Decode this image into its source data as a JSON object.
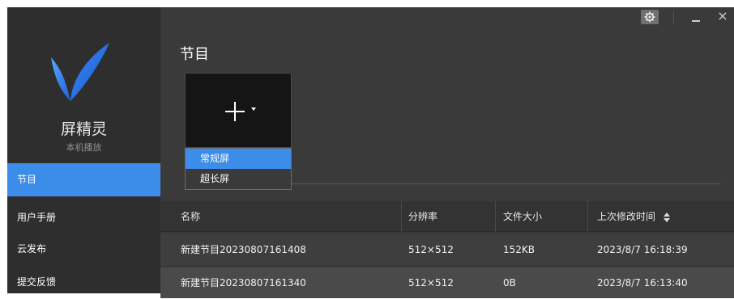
{
  "app": {
    "name": "屏精灵",
    "subtitle": "本机播放"
  },
  "sidebar": {
    "items": [
      {
        "label": "节目",
        "active": true
      },
      {
        "label": "用户手册",
        "active": false
      },
      {
        "label": "云发布",
        "active": false
      },
      {
        "label": "提交反馈",
        "active": false
      }
    ]
  },
  "window_controls": {
    "settings_icon": "gear-icon",
    "minimize_icon": "minimize-icon",
    "close": "×"
  },
  "main": {
    "title": "节目",
    "new_tile": {
      "icon": "plus-icon",
      "dropdown_icon": "caret-down-icon"
    },
    "dropdown": {
      "options": [
        "常规屏",
        "超长屏"
      ],
      "selected": "常规屏"
    }
  },
  "table": {
    "columns": [
      "名称",
      "分辨率",
      "文件大小",
      "上次修改时间"
    ],
    "sort_icon": "sort-icon",
    "rows": [
      {
        "name": "新建节目20230807161408",
        "resolution": "512×512",
        "size": "152KB",
        "modified": "2023/8/7 16:18:39"
      },
      {
        "name": "新建节目20230807161340",
        "resolution": "512×512",
        "size": "0B",
        "modified": "2023/8/7 16:13:40"
      }
    ]
  },
  "colors": {
    "accent": "#3c8de9",
    "sidebar_bg": "#2e2e2e",
    "main_bg": "#3a3a3a"
  }
}
